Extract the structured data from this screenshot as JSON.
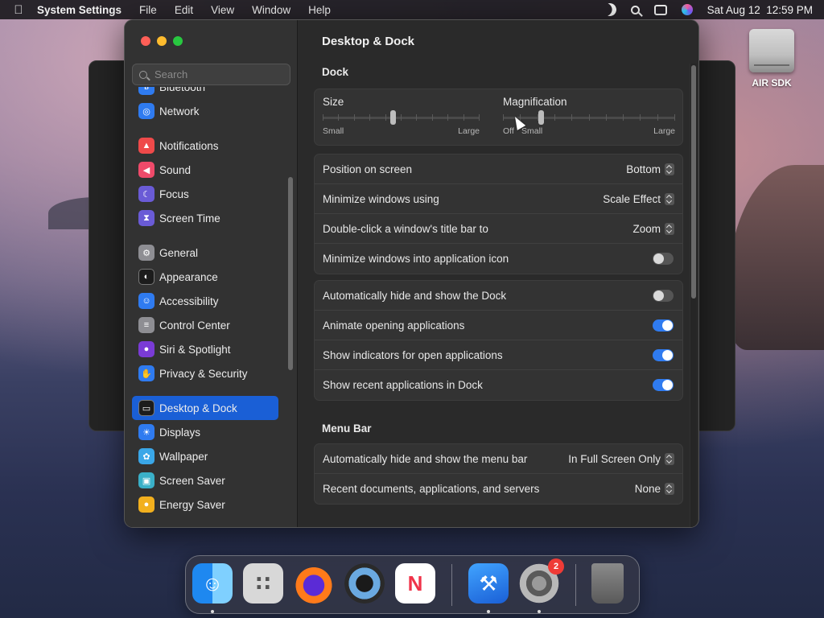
{
  "menubar": {
    "app_name": "System Settings",
    "menus": [
      "File",
      "Edit",
      "View",
      "Window",
      "Help"
    ],
    "clock": "Sat Aug 12  12:59 PM"
  },
  "desktop": {
    "drive_label": "AIR SDK"
  },
  "sidebar": {
    "search_placeholder": "Search",
    "items": [
      {
        "label": "Bluetooth",
        "icon": "bluetooth-icon",
        "color": "#2f7bf0"
      },
      {
        "label": "Network",
        "icon": "globe-icon",
        "color": "#2f7bf0"
      },
      {
        "label": "Notifications",
        "icon": "bell-icon",
        "color": "#ef4a4a"
      },
      {
        "label": "Sound",
        "icon": "speaker-icon",
        "color": "#ef4a6a"
      },
      {
        "label": "Focus",
        "icon": "moon-icon",
        "color": "#6a5bd6"
      },
      {
        "label": "Screen Time",
        "icon": "hourglass-icon",
        "color": "#6a5bd6"
      },
      {
        "label": "General",
        "icon": "gear-icon",
        "color": "#8e8e93"
      },
      {
        "label": "Appearance",
        "icon": "appearance-icon",
        "color": "#1c1c1c"
      },
      {
        "label": "Accessibility",
        "icon": "accessibility-icon",
        "color": "#2f7bf0"
      },
      {
        "label": "Control Center",
        "icon": "toggles-icon",
        "color": "#8e8e93"
      },
      {
        "label": "Siri & Spotlight",
        "icon": "siri-icon",
        "color": "#7a3bd6"
      },
      {
        "label": "Privacy & Security",
        "icon": "hand-icon",
        "color": "#2f7bf0"
      },
      {
        "label": "Desktop & Dock",
        "icon": "dock-icon",
        "color": "#1c1c1c",
        "active": true
      },
      {
        "label": "Displays",
        "icon": "sun-icon",
        "color": "#2f7bf0"
      },
      {
        "label": "Wallpaper",
        "icon": "flower-icon",
        "color": "#3aa7e8"
      },
      {
        "label": "Screen Saver",
        "icon": "screensaver-icon",
        "color": "#3ab0c8"
      },
      {
        "label": "Energy Saver",
        "icon": "bulb-icon",
        "color": "#f2b01e"
      }
    ]
  },
  "content": {
    "title": "Desktop & Dock",
    "dock_section": "Dock",
    "size_slider": {
      "label": "Size",
      "min_label": "Small",
      "max_label": "Large",
      "value": 0.45
    },
    "magnification_slider": {
      "label": "Magnification",
      "off_label": "Off",
      "min_label": "Small",
      "max_label": "Large",
      "value": 0.22
    },
    "position_rows": [
      {
        "label": "Position on screen",
        "value": "Bottom"
      },
      {
        "label": "Minimize windows using",
        "value": "Scale Effect"
      },
      {
        "label": "Double-click a window's title bar to",
        "value": "Zoom"
      }
    ],
    "minimize_into_icon": {
      "label": "Minimize windows into application icon",
      "on": false
    },
    "toggle_rows": [
      {
        "label": "Automatically hide and show the Dock",
        "on": false
      },
      {
        "label": "Animate opening applications",
        "on": true
      },
      {
        "label": "Show indicators for open applications",
        "on": true
      },
      {
        "label": "Show recent applications in Dock",
        "on": true
      }
    ],
    "menubar_section": "Menu Bar",
    "menubar_rows": [
      {
        "label": "Automatically hide and show the menu bar",
        "value": "In Full Screen Only"
      },
      {
        "label": "Recent documents, applications, and servers",
        "value": "None"
      }
    ]
  },
  "dock": {
    "apps": [
      {
        "name": "finder-icon",
        "running": true
      },
      {
        "name": "launchpad-icon",
        "running": false
      },
      {
        "name": "firefox-icon",
        "running": false
      },
      {
        "name": "quicktime-icon",
        "running": false
      },
      {
        "name": "news-icon",
        "running": false
      },
      {
        "name": "xcode-icon",
        "running": true
      },
      {
        "name": "system-settings-icon",
        "running": true,
        "badge": "2"
      },
      {
        "name": "trash-icon",
        "running": false
      }
    ]
  }
}
